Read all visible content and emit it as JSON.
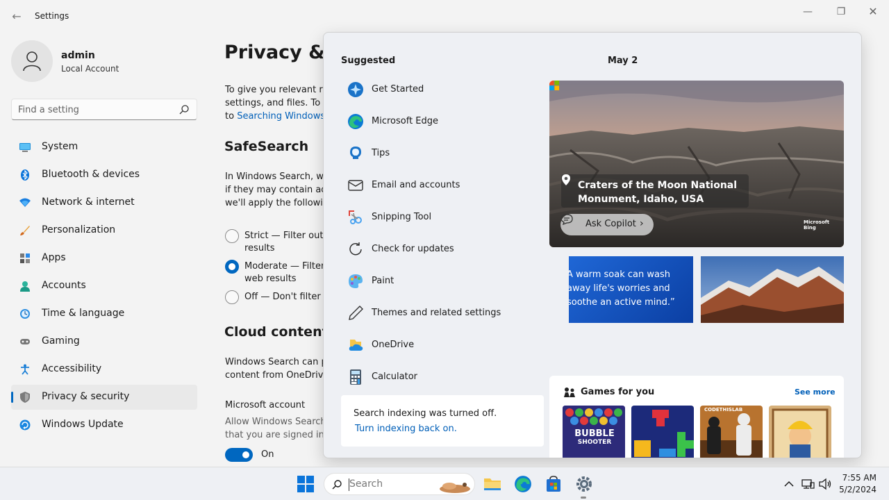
{
  "window": {
    "title": "Settings",
    "back_icon": "back-arrow-icon",
    "controls": {
      "minimize": "—",
      "maximize": "❐",
      "close": "✕"
    }
  },
  "profile": {
    "name": "admin",
    "type": "Local Account"
  },
  "search": {
    "placeholder": "Find a setting"
  },
  "nav": {
    "items": [
      {
        "label": "System",
        "icon": "system-icon"
      },
      {
        "label": "Bluetooth & devices",
        "icon": "bluetooth-icon"
      },
      {
        "label": "Network & internet",
        "icon": "network-icon"
      },
      {
        "label": "Personalization",
        "icon": "personalization-icon"
      },
      {
        "label": "Apps",
        "icon": "apps-icon"
      },
      {
        "label": "Accounts",
        "icon": "accounts-icon"
      },
      {
        "label": "Time & language",
        "icon": "time-language-icon"
      },
      {
        "label": "Gaming",
        "icon": "gaming-icon"
      },
      {
        "label": "Accessibility",
        "icon": "accessibility-icon"
      },
      {
        "label": "Privacy & security",
        "icon": "shield-icon",
        "active": true
      },
      {
        "label": "Windows Update",
        "icon": "windows-update-icon"
      }
    ]
  },
  "content": {
    "title": "Privacy & se",
    "intro_lines": [
      "To give you relevant res",
      "settings, and files. To ch",
      "to "
    ],
    "intro_link": "Searching Windows",
    "safesearch_title": "SafeSearch",
    "safesearch_lines": [
      "In Windows Search, we",
      "if they may contain adu",
      "we'll apply the followin"
    ],
    "options": [
      {
        "line1": "Strict — Filter out a",
        "line2": "results",
        "checked": false
      },
      {
        "line1": "Moderate — Filter",
        "line2": "web results",
        "checked": true
      },
      {
        "line1": "Off — Don't filter a",
        "line2": "",
        "checked": false
      }
    ],
    "cloud_title": "Cloud content s",
    "cloud_lines": [
      "Windows Search can pe",
      "content from OneDrive"
    ],
    "ms_account_title": "Microsoft account",
    "ms_account_lines": [
      "Allow Windows Search",
      "that you are signed in t"
    ],
    "toggle_label": "On",
    "toggle_on": true
  },
  "start": {
    "suggested_title": "Suggested",
    "apps": [
      {
        "label": "Get Started",
        "icon": "get-started-icon"
      },
      {
        "label": "Microsoft Edge",
        "icon": "edge-icon"
      },
      {
        "label": "Tips",
        "icon": "tips-icon"
      },
      {
        "label": "Email and accounts",
        "icon": "mail-icon"
      },
      {
        "label": "Snipping Tool",
        "icon": "snipping-tool-icon"
      },
      {
        "label": "Check for updates",
        "icon": "refresh-icon"
      },
      {
        "label": "Paint",
        "icon": "paint-icon"
      },
      {
        "label": "Themes and related settings",
        "icon": "pen-icon"
      },
      {
        "label": "OneDrive",
        "icon": "onedrive-icon"
      },
      {
        "label": "Calculator",
        "icon": "calculator-icon"
      }
    ],
    "indexing": {
      "message": "Search indexing was turned off.",
      "link": "Turn indexing back on."
    },
    "date": "May 2",
    "hero": {
      "location": "Craters of the Moon National Monument, Idaho, USA",
      "copilot": "Ask Copilot",
      "brand_line1": "Microsoft",
      "brand_line2": "Bing"
    },
    "quote_lines": [
      "A warm soak can wash",
      "away life's worries and",
      "soothe an active mind.”"
    ],
    "games": {
      "title": "Games for you",
      "see_more": "See more",
      "tiles": [
        {
          "name": "bubble-shooter-tile",
          "line1": "BUBBLE",
          "line2": "SHOOTER"
        },
        {
          "name": "block-puzzle-tile"
        },
        {
          "name": "chess-tile",
          "caption": "CODETHISLAB"
        },
        {
          "name": "miner-tile"
        }
      ]
    }
  },
  "taskbar": {
    "search_placeholder": "Search",
    "apps": [
      "start-icon",
      "file-explorer-icon",
      "edge-icon",
      "store-icon",
      "settings-icon"
    ],
    "time": "7:55 AM",
    "date": "5/2/2024"
  },
  "colors": {
    "accent": "#0067c0",
    "link": "#005fb8"
  }
}
